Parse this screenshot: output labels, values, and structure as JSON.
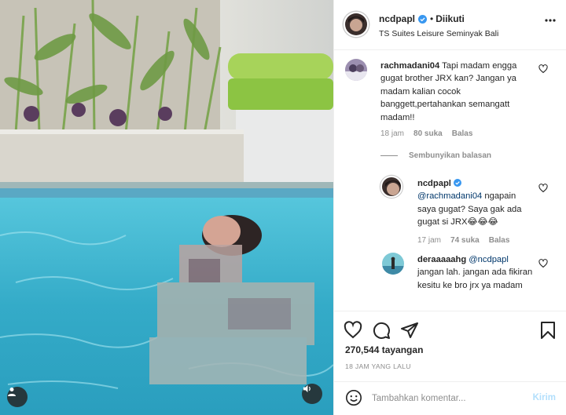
{
  "post": {
    "username": "ncdpapl",
    "follow_separator": "•",
    "follow_state": "Diikuti",
    "location": "TS Suites Leisure Seminyak Bali"
  },
  "comments": [
    {
      "username": "rachmadani04",
      "text": "Tapi madam engga gugat brother JRX kan? Jangan ya madam kalian cocok banggett,pertahankan semangatt madam!!",
      "time": "18 jam",
      "likes": "80 suka",
      "reply_label": "Balas"
    }
  ],
  "hide_replies_label": "Sembunyikan balasan",
  "replies": [
    {
      "username": "ncdpapl",
      "mention": "@rachmadani04",
      "text": " ngapain saya gugat? Saya gak ada gugat si JRX😂😂😂",
      "time": "17 jam",
      "likes": "74 suka",
      "reply_label": "Balas"
    },
    {
      "username": "deraaaaahg",
      "mention": "@ncdpapl",
      "text": " jangan lah. jangan ada fikiran kesitu ke bro jrx ya madam"
    }
  ],
  "stats": {
    "views": "270,544 tayangan",
    "time_ago": "18 JAM YANG LALU"
  },
  "composer": {
    "placeholder": "Tambahkan komentar...",
    "post_label": "Kirim"
  },
  "colors": {
    "verified": "#3897f0",
    "link": "#00376b",
    "muted": "#8e8e8e",
    "pool": "#3ab4cf"
  },
  "icons": [
    "more-options-icon",
    "verified-badge-icon",
    "heart-icon",
    "comment-icon",
    "share-icon",
    "bookmark-icon",
    "emoji-icon",
    "user-tag-icon",
    "sound-icon"
  ]
}
